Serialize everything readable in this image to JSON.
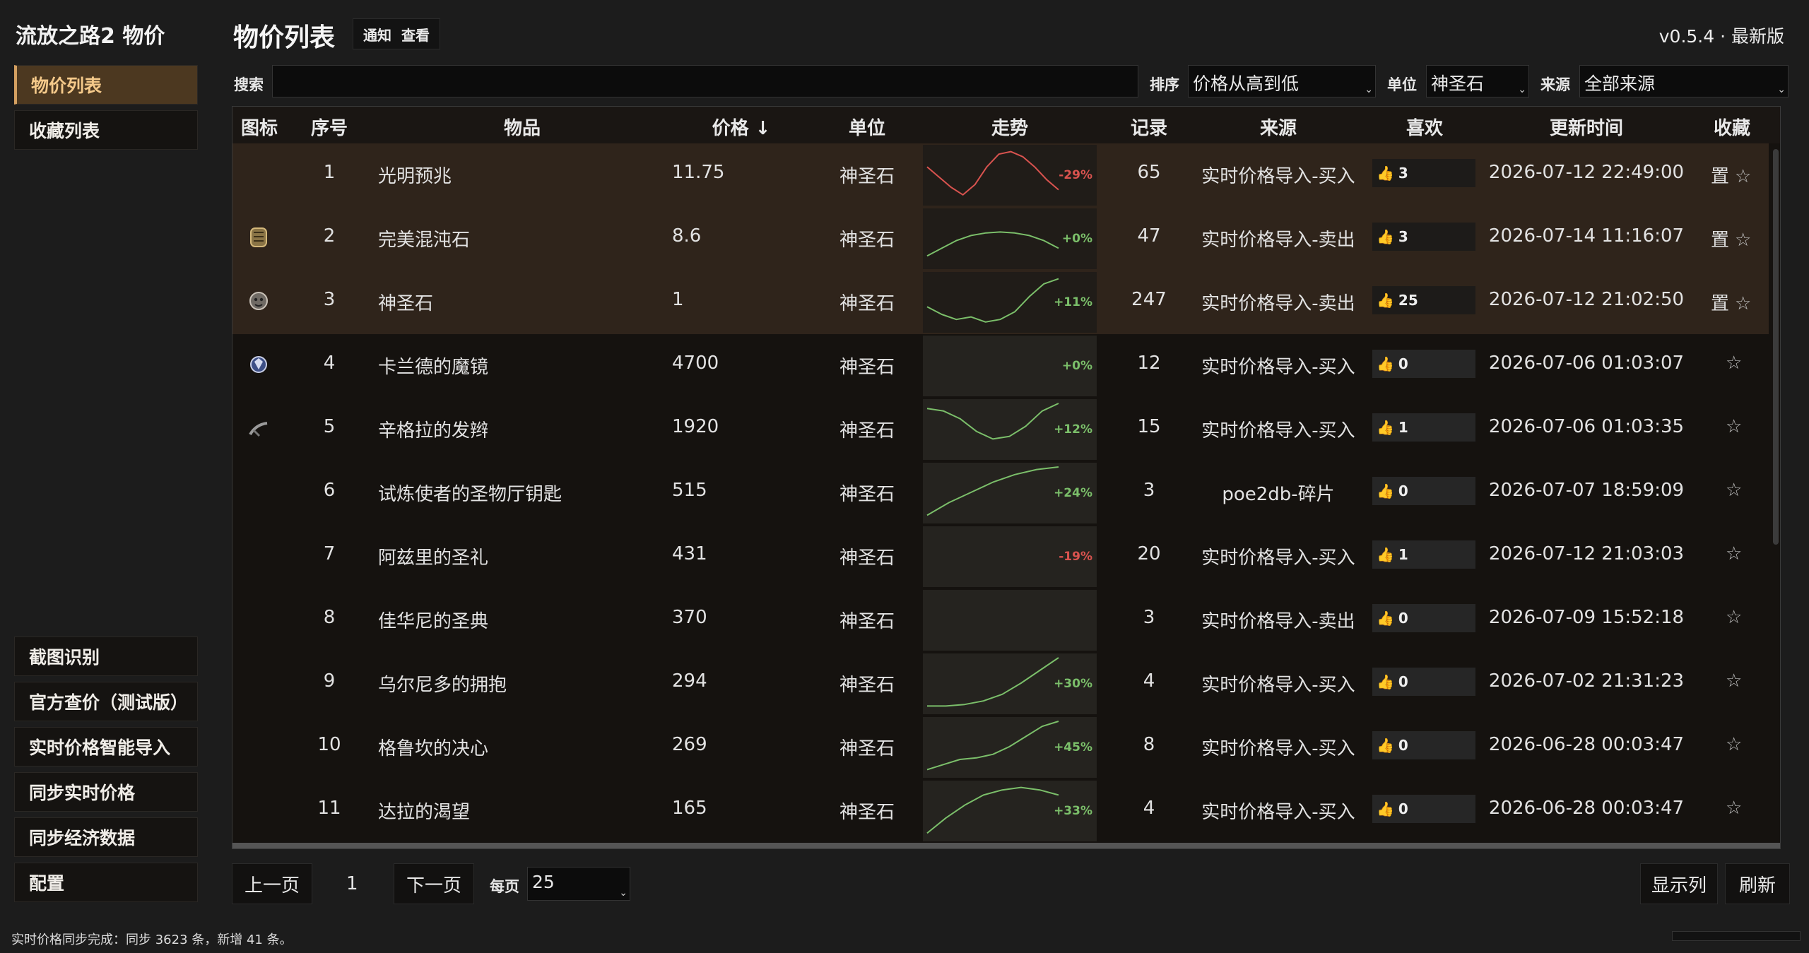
{
  "app": {
    "title": "流放之路2 物价",
    "version": "v0.5.4 · 最新版"
  },
  "sidebar": {
    "top_items": [
      {
        "label": "物价列表",
        "active": true
      },
      {
        "label": "收藏列表",
        "active": false
      }
    ],
    "bottom_items": [
      {
        "label": "截图识别"
      },
      {
        "label": "官方查价（测试版）"
      },
      {
        "label": "实时价格智能导入"
      },
      {
        "label": "同步实时价格"
      },
      {
        "label": "同步经济数据"
      },
      {
        "label": "配置"
      }
    ]
  },
  "header": {
    "title": "物价列表",
    "notify_label": "通知",
    "view_label": "查看"
  },
  "filters": {
    "search_label": "搜索",
    "search_value": "",
    "sort_label": "排序",
    "sort_value": "价格从高到低",
    "unit_label": "单位",
    "unit_value": "神圣石",
    "source_label": "来源",
    "source_value": "全部来源"
  },
  "table": {
    "columns": [
      "图标",
      "序号",
      "物品",
      "价格 ↓",
      "单位",
      "走势",
      "记录",
      "来源",
      "喜欢",
      "更新时间",
      "收藏"
    ],
    "pin_label": "置",
    "star": "☆",
    "rows": [
      {
        "idx": "1",
        "name": "光明预兆",
        "price": "11.75",
        "unit": "神圣石",
        "trend": "-29%",
        "trend_dir": "down",
        "records": "65",
        "source": "实时价格导入-买入",
        "likes": "3",
        "updated": "2026-07-12 22:49:00",
        "pinned": true,
        "icon": "none",
        "trend_points": [
          0.35,
          0.55,
          0.75,
          0.9,
          0.7,
          0.35,
          0.1,
          0.05,
          0.15,
          0.35,
          0.6,
          0.8
        ]
      },
      {
        "idx": "2",
        "name": "完美混沌石",
        "price": "8.6",
        "unit": "神圣石",
        "trend": "+0%",
        "trend_dir": "up",
        "records": "47",
        "source": "实时价格导入-卖出",
        "likes": "3",
        "updated": "2026-07-14 11:16:07",
        "pinned": true,
        "icon": "chaos-orb-icon",
        "trend_points": [
          0.85,
          0.7,
          0.55,
          0.45,
          0.4,
          0.38,
          0.4,
          0.45,
          0.55,
          0.7
        ]
      },
      {
        "idx": "3",
        "name": "神圣石",
        "price": "1",
        "unit": "神圣石",
        "trend": "+11%",
        "trend_dir": "up",
        "records": "247",
        "source": "实时价格导入-卖出",
        "likes": "25",
        "updated": "2026-07-12 21:02:50",
        "pinned": true,
        "icon": "divine-orb-icon",
        "trend_points": [
          0.6,
          0.75,
          0.85,
          0.8,
          0.9,
          0.85,
          0.7,
          0.4,
          0.15,
          0.05
        ]
      },
      {
        "idx": "4",
        "name": "卡兰德的魔镜",
        "price": "4700",
        "unit": "神圣石",
        "trend": "+0%",
        "trend_dir": "up",
        "records": "12",
        "source": "实时价格导入-买入",
        "likes": "0",
        "updated": "2026-07-06 01:03:07",
        "pinned": false,
        "icon": "mirror-icon",
        "trend_points": []
      },
      {
        "idx": "5",
        "name": "辛格拉的发辫",
        "price": "1920",
        "unit": "神圣石",
        "trend": "+12%",
        "trend_dir": "up",
        "records": "15",
        "source": "实时价格导入-买入",
        "likes": "1",
        "updated": "2026-07-06 01:03:35",
        "pinned": false,
        "icon": "braid-icon",
        "trend_points": [
          0.1,
          0.15,
          0.3,
          0.55,
          0.7,
          0.65,
          0.45,
          0.15,
          0.0
        ]
      },
      {
        "idx": "6",
        "name": "试炼使者的圣物厅钥匙",
        "price": "515",
        "unit": "神圣石",
        "trend": "+24%",
        "trend_dir": "up",
        "records": "3",
        "source": "poe2db-碎片",
        "likes": "0",
        "updated": "2026-07-07 18:59:09",
        "pinned": false,
        "icon": "none",
        "trend_points": [
          0.95,
          0.7,
          0.5,
          0.3,
          0.15,
          0.05,
          0.0
        ]
      },
      {
        "idx": "7",
        "name": "阿兹里的圣礼",
        "price": "431",
        "unit": "神圣石",
        "trend": "-19%",
        "trend_dir": "down",
        "records": "20",
        "source": "实时价格导入-买入",
        "likes": "1",
        "updated": "2026-07-12 21:03:03",
        "pinned": false,
        "icon": "none",
        "trend_points": []
      },
      {
        "idx": "8",
        "name": "佳华尼的圣典",
        "price": "370",
        "unit": "神圣石",
        "trend": "",
        "trend_dir": "none",
        "records": "3",
        "source": "实时价格导入-卖出",
        "likes": "0",
        "updated": "2026-07-09 15:52:18",
        "pinned": false,
        "icon": "none",
        "trend_points": []
      },
      {
        "idx": "9",
        "name": "乌尔尼多的拥抱",
        "price": "294",
        "unit": "神圣石",
        "trend": "+30%",
        "trend_dir": "up",
        "records": "4",
        "source": "实时价格导入-买入",
        "likes": "0",
        "updated": "2026-07-02 21:31:23",
        "pinned": false,
        "icon": "none",
        "trend_points": [
          0.95,
          0.95,
          0.92,
          0.85,
          0.72,
          0.5,
          0.25,
          0.0
        ]
      },
      {
        "idx": "10",
        "name": "格鲁坎的决心",
        "price": "269",
        "unit": "神圣石",
        "trend": "+45%",
        "trend_dir": "up",
        "records": "8",
        "source": "实时价格导入-买入",
        "likes": "0",
        "updated": "2026-06-28 00:03:47",
        "pinned": false,
        "icon": "none",
        "trend_points": [
          0.95,
          0.85,
          0.75,
          0.72,
          0.65,
          0.5,
          0.3,
          0.1,
          0.0
        ]
      },
      {
        "idx": "11",
        "name": "达拉的渴望",
        "price": "165",
        "unit": "神圣石",
        "trend": "+33%",
        "trend_dir": "up",
        "records": "4",
        "source": "实时价格导入-买入",
        "likes": "0",
        "updated": "2026-06-28 00:03:47",
        "pinned": false,
        "icon": "none",
        "trend_points": [
          0.95,
          0.65,
          0.4,
          0.2,
          0.1,
          0.05,
          0.1,
          0.2
        ]
      }
    ]
  },
  "pagination": {
    "prev_label": "上一页",
    "page": "1",
    "next_label": "下一页",
    "per_page_label": "每页",
    "per_page_value": "25",
    "columns_label": "显示列",
    "refresh_label": "刷新"
  },
  "status": {
    "text": "实时价格同步完成：同步 3623 条，新增 41 条。"
  },
  "colors": {
    "up": "#7bbf6a",
    "down": "#d9534f",
    "active_nav": "#4c3820",
    "highlight_row": "#2f241b"
  }
}
